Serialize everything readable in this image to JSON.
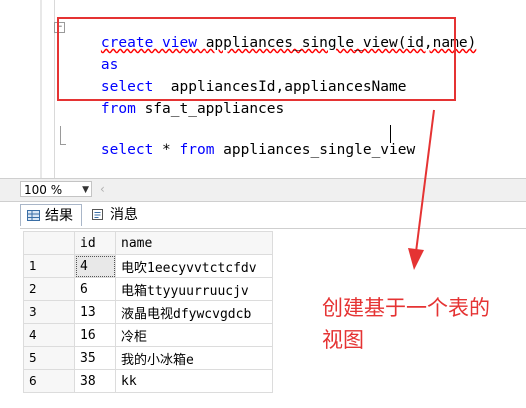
{
  "editor": {
    "lines": [
      {
        "parts": [
          {
            "t": "create view ",
            "k": true,
            "u": true
          },
          {
            "t": "appliances_single_view(id,name)",
            "k": false,
            "u": true
          }
        ]
      },
      {
        "parts": [
          {
            "t": "as",
            "k": true,
            "u": false
          }
        ]
      },
      {
        "parts": [
          {
            "t": "select",
            "k": true,
            "u": false
          },
          {
            "t": "  appliancesId,appliancesName",
            "k": false,
            "u": false
          }
        ]
      },
      {
        "parts": [
          {
            "t": "from",
            "k": true,
            "u": false
          },
          {
            "t": " sfa_t_appliances",
            "k": false,
            "u": false
          }
        ]
      }
    ],
    "line5": {
      "kw1": "select",
      "star": " * ",
      "kw2": "from",
      "rest": " appliances_single_view"
    },
    "keyword_color": "#0000ff",
    "highlight_color": "#e53333"
  },
  "toolbar": {
    "zoom": "100 %",
    "dropdown_icon": "chevron-down-icon",
    "scroll_icon": "scroll-left-icon"
  },
  "tabs": [
    {
      "label": "结果",
      "icon": "grid-icon",
      "active": true
    },
    {
      "label": "消息",
      "icon": "message-icon",
      "active": false
    }
  ],
  "results": {
    "columns": [
      "id",
      "name"
    ],
    "rows": [
      {
        "n": "1",
        "id": "4",
        "name": "电吹1eecyvvtctcfdv"
      },
      {
        "n": "2",
        "id": "6",
        "name": "电箱ttyyuurruucjv"
      },
      {
        "n": "3",
        "id": "13",
        "name": "液晶电视dfywcvgdcb"
      },
      {
        "n": "4",
        "id": "16",
        "name": "冷柜"
      },
      {
        "n": "5",
        "id": "35",
        "name": "我的小冰箱e"
      },
      {
        "n": "6",
        "id": "38",
        "name": "kk"
      }
    ]
  },
  "annotation": {
    "line1": "创建基于一个表的",
    "line2": "视图"
  }
}
